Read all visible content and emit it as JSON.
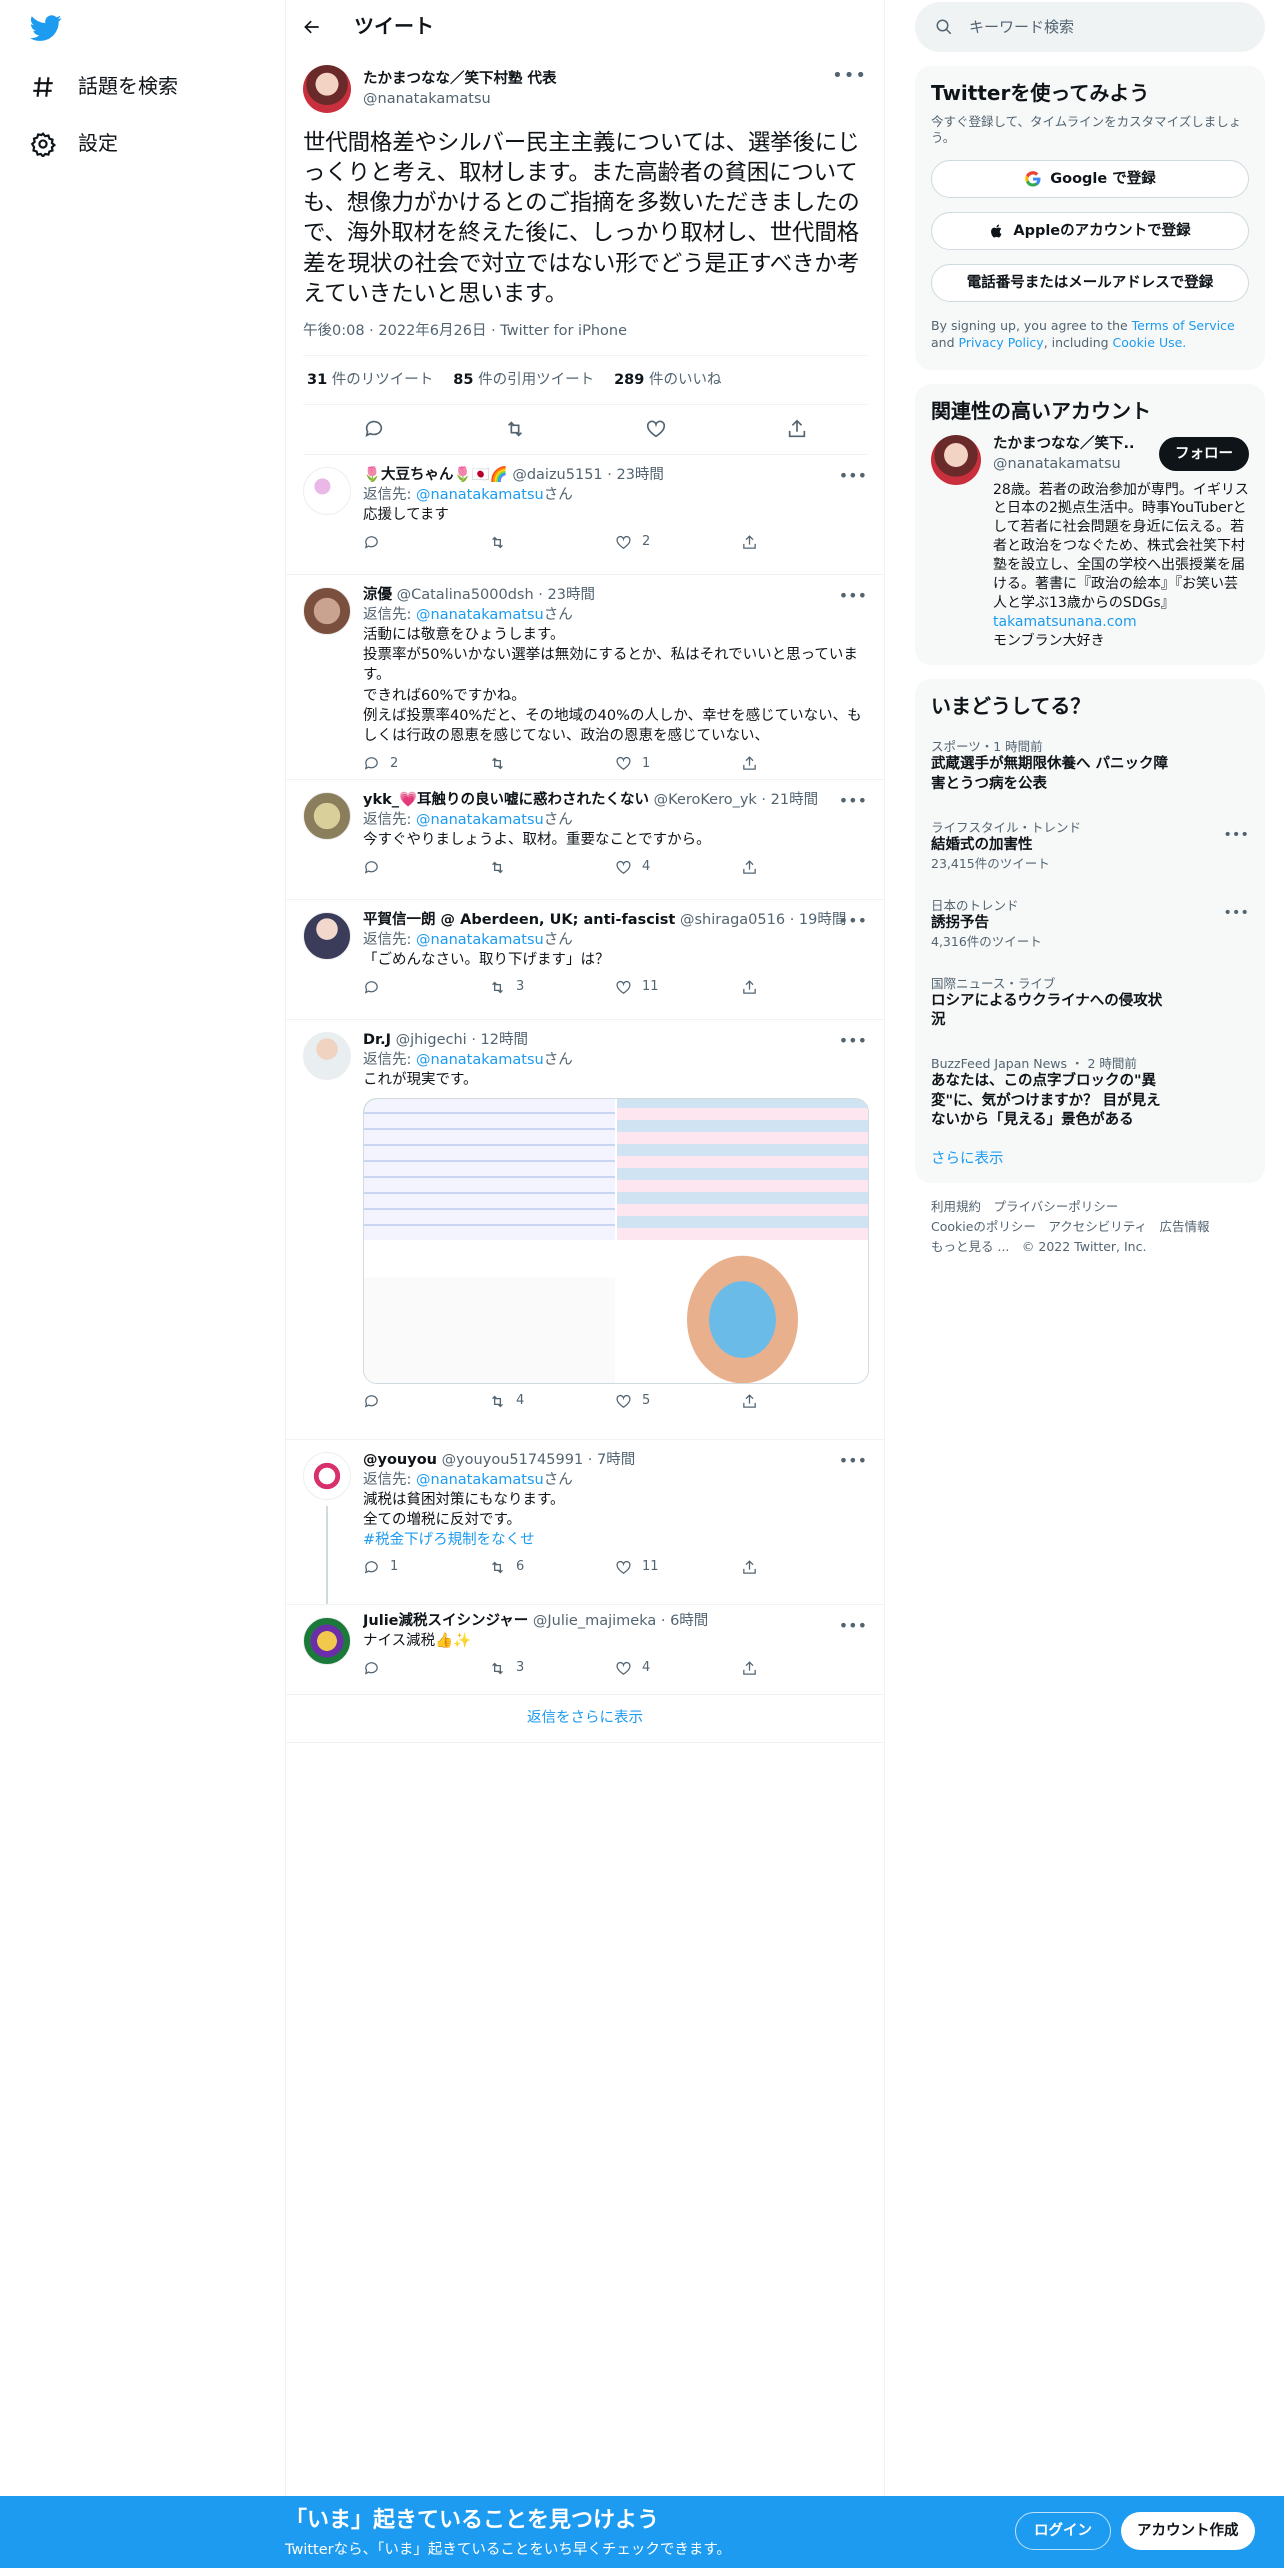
{
  "nav": {
    "explore_label": "話題を検索",
    "settings_label": "設定"
  },
  "header": {
    "title": "ツイート"
  },
  "main_tweet": {
    "name": "たかまつなな／笑下村塾 代表",
    "handle": "@nanatakamatsu",
    "text": "世代間格差やシルバー民主主義については、選挙後にじっくりと考え、取材します。また高齢者の貧困についても、想像力がかけるとのご指摘を多数いただきましたので、海外取材を終えた後に、しっかり取材し、世代間格差を現状の社会で対立ではない形でどう是正すべきか考えていきたいと思います。",
    "time": "午後0:08",
    "date": "2022年6月26日",
    "source": "Twitter for iPhone",
    "retweets": "31",
    "retweets_label": "件のリツイート",
    "quotes": "85",
    "quotes_label": "件の引用ツイート",
    "likes": "289",
    "likes_label": "件のいいね"
  },
  "replies": [
    {
      "name": "🌷大豆ちゃん🌷🇯🇵🌈",
      "handle": "@daizu5151",
      "time": "23時間",
      "reply_prefix": "返信先: ",
      "reply_to": "@nanatakamatsu",
      "reply_suffix": "さん",
      "text": "応援してます",
      "replies": "",
      "retweets": "",
      "likes": "2"
    },
    {
      "name": "涼優",
      "handle": "@Catalina5000dsh",
      "time": "23時間",
      "reply_prefix": "返信先: ",
      "reply_to": "@nanatakamatsu",
      "reply_suffix": "さん",
      "text": "活動には敬意をひょうします。\n投票率が50%いかない選挙は無効にするとか、私はそれでいいと思っています。\nできれば60%ですかね。\n例えば投票率40%だと、その地域の40%の人しか、幸せを感じていない、もしくは行政の恩恵を感じてない、政治の恩恵を感じていない、",
      "replies": "2",
      "retweets": "",
      "likes": "1"
    },
    {
      "name": "ykk_💗耳触りの良い嘘に惑わされたくない",
      "handle": "@KeroKero_yk",
      "time": "21時間",
      "reply_prefix": "返信先: ",
      "reply_to": "@nanatakamatsu",
      "reply_suffix": "さん",
      "text": "今すぐやりましょうよ、取材。重要なことですから。",
      "replies": "",
      "retweets": "",
      "likes": "4"
    },
    {
      "name": "平賀信一朗 @ Aberdeen, UK; anti-fascist",
      "handle": "@shiraga0516",
      "time": "19時間",
      "reply_prefix": "返信先: ",
      "reply_to": "@nanatakamatsu",
      "reply_suffix": "さん",
      "text": "「ごめんなさい。取り下げます」は？",
      "replies": "",
      "retweets": "3",
      "likes": "11"
    },
    {
      "name": "Dr.J",
      "handle": "@jhigechi",
      "time": "12時間",
      "reply_prefix": "返信先: ",
      "reply_to": "@nanatakamatsu",
      "reply_suffix": "さん",
      "text": "これが現実です。",
      "replies": "",
      "retweets": "4",
      "likes": "5"
    },
    {
      "name": "@youyou",
      "handle": "@youyou51745991",
      "time": "7時間",
      "reply_prefix": "返信先: ",
      "reply_to": "@nanatakamatsu",
      "reply_suffix": "さん",
      "text": "減税は貧困対策にもなります。\n全ての増税に反対です。",
      "hashtag": "#税金下げろ規制をなくせ",
      "replies": "1",
      "retweets": "6",
      "likes": "11"
    },
    {
      "name": "Julie減税スイシンジャー",
      "handle": "@Julie_majimeka",
      "time": "6時間",
      "text": "ナイス減税👍✨",
      "replies": "",
      "retweets": "3",
      "likes": "4"
    }
  ],
  "show_more_replies": "返信をさらに表示",
  "search": {
    "placeholder": "キーワード検索"
  },
  "signup_card": {
    "title": "Twitterを使ってみよう",
    "subtitle": "今すぐ登録して、タイムラインをカスタマイズしましょう。",
    "google": "Google で登録",
    "apple": "Appleのアカウントで登録",
    "phone": "電話番号またはメールアドレスで登録",
    "legal_prefix": "By signing up, you agree to the ",
    "tos": "Terms of Service",
    "and": " and ",
    "privacy": "Privacy Policy",
    "including": ", including ",
    "cookie": "Cookie Use."
  },
  "related": {
    "title": "関連性の高いアカウント",
    "name": "たかまつなな／笑下...",
    "handle": "@nanatakamatsu",
    "follow": "フォロー",
    "bio": "28歳。若者の政治参加が専門。イギリスと日本の2拠点生活中。時事YouTuberとして若者に社会問題を身近に伝える。若者と政治をつなぐため、株式会社笑下村塾を設立し、全国の学校へ出張授業を届ける。著書に『政治の絵本』『お笑い芸人と学ぶ13歳からのSDGs』",
    "link": "takamatsunana.com",
    "bio_end": "モンブラン大好き"
  },
  "trends": {
    "title": "いまどうしてる？",
    "items": [
      {
        "category": "スポーツ・1 時間前",
        "name": "武蔵選手が無期限休養へ パニック障害とうつ病を公表",
        "count": ""
      },
      {
        "category": "ライフスタイル・トレンド",
        "name": "結婚式の加害性",
        "count": "23,415件のツイート"
      },
      {
        "category": "日本のトレンド",
        "name": "誘拐予告",
        "count": "4,316件のツイート"
      },
      {
        "category": "国際ニュース・ライブ",
        "name": "ロシアによるウクライナへの侵攻状況",
        "count": ""
      },
      {
        "category": "BuzzFeed Japan News ・ 2 時間前",
        "name": "あなたは、この点字ブロックの\"異変\"に、気がつけますか？ 目が見えないから「見える」景色がある",
        "count": ""
      }
    ],
    "show_more": "さらに表示"
  },
  "footer": {
    "line1": "利用規約　プライバシーポリシー",
    "line2": "Cookieのポリシー　アクセシビリティ　広告情報",
    "line3": "もっと見る ...　© 2022 Twitter, Inc."
  },
  "bottom_bar": {
    "heading": "「いま」起きていることを見つけよう",
    "sub": "Twitterなら、「いま」起きていることをいち早くチェックできます。",
    "login": "ログイン",
    "signup": "アカウント作成"
  },
  "colors": {
    "accent": "#1d9bf0",
    "text": "#0f1419",
    "muted": "#536471",
    "border": "#eff3f4"
  }
}
